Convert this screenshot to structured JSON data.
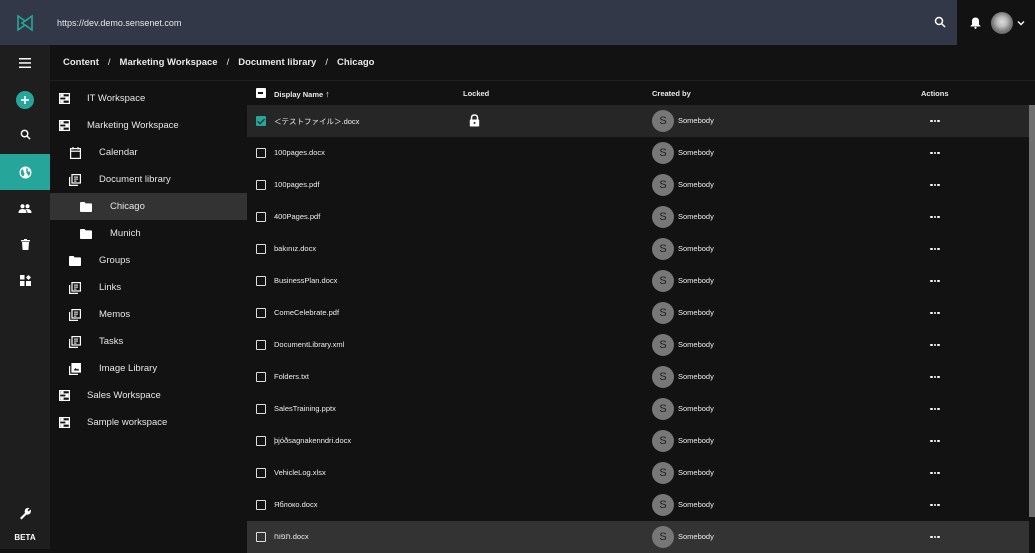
{
  "header": {
    "url": "https://dev.demo.sensenet.com",
    "logo_icon": "sensenet-logo-icon",
    "search_icon": "search-icon",
    "notifications_icon": "bell-icon",
    "user_menu_icon": "chevron-down-icon"
  },
  "colors": {
    "accent": "#26a69a",
    "header_bg": "#323848",
    "surface": "#121212",
    "rail_bg": "#1e1e1e"
  },
  "rail": {
    "items": [
      {
        "name": "menu",
        "icon": "hamburger-icon"
      },
      {
        "name": "add",
        "icon": "plus-icon"
      },
      {
        "name": "search",
        "icon": "search-icon"
      },
      {
        "name": "content",
        "icon": "globe-icon",
        "active": true
      },
      {
        "name": "users",
        "icon": "people-icon"
      },
      {
        "name": "trash",
        "icon": "trash-icon"
      },
      {
        "name": "apps",
        "icon": "widgets-icon"
      },
      {
        "name": "settings",
        "icon": "wrench-icon"
      }
    ],
    "beta_label": "BETA"
  },
  "breadcrumb": [
    "Content",
    "Marketing Workspace",
    "Document library",
    "Chicago"
  ],
  "breadcrumb_separator": "/",
  "tree": [
    {
      "label": "IT Workspace",
      "icon": "workspace-icon",
      "level": 0
    },
    {
      "label": "Marketing Workspace",
      "icon": "workspace-icon",
      "level": 0
    },
    {
      "label": "Calendar",
      "icon": "calendar-icon",
      "level": 1
    },
    {
      "label": "Document library",
      "icon": "library-icon",
      "level": 1
    },
    {
      "label": "Chicago",
      "icon": "folder-icon",
      "level": 2,
      "selected": true
    },
    {
      "label": "Munich",
      "icon": "folder-icon",
      "level": 2
    },
    {
      "label": "Groups",
      "icon": "folder-icon",
      "level": 1
    },
    {
      "label": "Links",
      "icon": "library-icon",
      "level": 1
    },
    {
      "label": "Memos",
      "icon": "library-icon",
      "level": 1
    },
    {
      "label": "Tasks",
      "icon": "library-icon",
      "level": 1
    },
    {
      "label": "Image Library",
      "icon": "image-library-icon",
      "level": 1
    },
    {
      "label": "Sales Workspace",
      "icon": "workspace-icon",
      "level": 0
    },
    {
      "label": "Sample workspace",
      "icon": "workspace-icon",
      "level": 0
    }
  ],
  "grid": {
    "columns": {
      "display_name": "Display Name",
      "sort_indicator": "↑",
      "locked": "Locked",
      "created_by": "Created by",
      "actions": "Actions"
    },
    "rows": [
      {
        "name": "＜テストファイル＞.docx",
        "locked": true,
        "created_by": "Somebody",
        "avatar_initial": "S",
        "checked": true
      },
      {
        "name": "100pages.docx",
        "locked": false,
        "created_by": "Somebody",
        "avatar_initial": "S",
        "checked": false
      },
      {
        "name": "100pages.pdf",
        "locked": false,
        "created_by": "Somebody",
        "avatar_initial": "S",
        "checked": false
      },
      {
        "name": "400Pages.pdf",
        "locked": false,
        "created_by": "Somebody",
        "avatar_initial": "S",
        "checked": false
      },
      {
        "name": "bakınız.docx",
        "locked": false,
        "created_by": "Somebody",
        "avatar_initial": "S",
        "checked": false
      },
      {
        "name": "BusinessPlan.docx",
        "locked": false,
        "created_by": "Somebody",
        "avatar_initial": "S",
        "checked": false
      },
      {
        "name": "ComeCelebrate.pdf",
        "locked": false,
        "created_by": "Somebody",
        "avatar_initial": "S",
        "checked": false
      },
      {
        "name": "DocumentLibrary.xml",
        "locked": false,
        "created_by": "Somebody",
        "avatar_initial": "S",
        "checked": false
      },
      {
        "name": "Folders.txt",
        "locked": false,
        "created_by": "Somebody",
        "avatar_initial": "S",
        "checked": false
      },
      {
        "name": "SalesTraining.pptx",
        "locked": false,
        "created_by": "Somebody",
        "avatar_initial": "S",
        "checked": false
      },
      {
        "name": "þjóðsagnakenndri.docx",
        "locked": false,
        "created_by": "Somebody",
        "avatar_initial": "S",
        "checked": false
      },
      {
        "name": "VehicleLog.xlsx",
        "locked": false,
        "created_by": "Somebody",
        "avatar_initial": "S",
        "checked": false
      },
      {
        "name": "Яблоко.docx",
        "locked": false,
        "created_by": "Somebody",
        "avatar_initial": "S",
        "checked": false
      },
      {
        "name": "תפוח.docx",
        "locked": false,
        "created_by": "Somebody",
        "avatar_initial": "S",
        "checked": false
      }
    ]
  }
}
